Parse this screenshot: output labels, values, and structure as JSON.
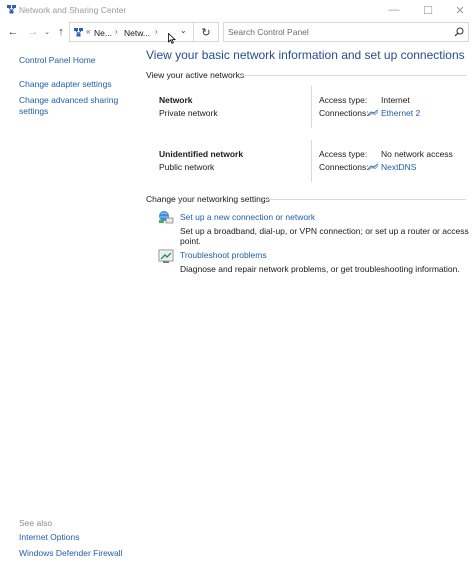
{
  "window": {
    "title": "Network and Sharing Center",
    "minimize": "—",
    "maximize": "☐",
    "close": "✕"
  },
  "nav": {
    "back": "←",
    "forward": "→",
    "recent": "⌄",
    "up": "↑",
    "crumb_sep1": "«",
    "crumb1": "Ne...",
    "crumb_sep2": "›",
    "crumb2": "Netw...",
    "crumb_sep3": "›",
    "address_dropdown": "⌄",
    "refresh": "↻"
  },
  "search": {
    "placeholder": "Search Control Panel"
  },
  "sidebar": {
    "items": [
      {
        "label": "Control Panel Home"
      },
      {
        "label": "Change adapter settings"
      },
      {
        "label": "Change advanced sharing"
      },
      {
        "label": "settings"
      }
    ]
  },
  "see_also": {
    "header": "See also",
    "items": [
      {
        "label": "Internet Options"
      },
      {
        "label": "Windows Defender Firewall"
      }
    ]
  },
  "main": {
    "title": "View your basic network information and set up connections",
    "active_header": "View your active networks",
    "networks": [
      {
        "name": "Network",
        "category": "Private network",
        "access_label": "Access type:",
        "access_value": "Internet",
        "connections_label": "Connections:",
        "connection": "Ethernet 2"
      },
      {
        "name": "Unidentified network",
        "category": "Public network",
        "access_label": "Access type:",
        "access_value": "No network access",
        "connections_label": "Connections:",
        "connection": "NextDNS"
      }
    ],
    "change_header": "Change your networking settings",
    "tasks": [
      {
        "link": "Set up a new connection or network",
        "desc": "Set up a broadband, dial-up, or VPN connection; or set up a router or access point."
      },
      {
        "link": "Troubleshoot problems",
        "desc": "Diagnose and repair network problems, or get troubleshooting information."
      }
    ]
  },
  "colors": {
    "link": "#1f5ea8",
    "title": "#1f4f8f",
    "divider": "#d9d9d9"
  }
}
